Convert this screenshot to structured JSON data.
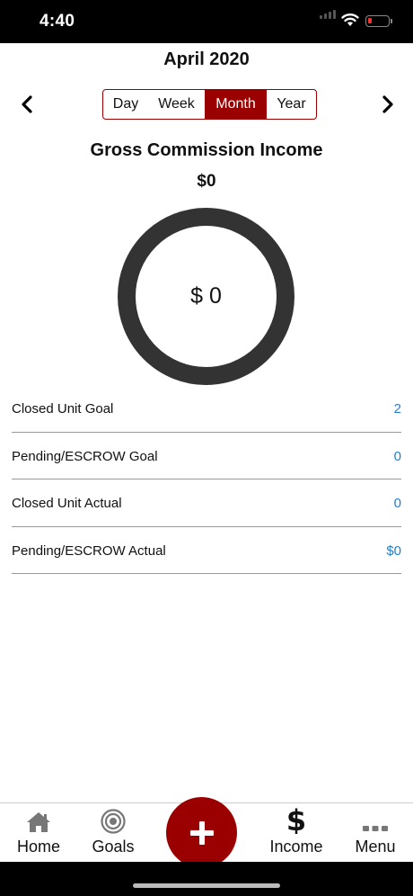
{
  "status_bar": {
    "time": "4:40"
  },
  "header": {
    "title": "April 2020"
  },
  "period_selector": {
    "options": [
      "Day",
      "Week",
      "Month",
      "Year"
    ],
    "selected": "Month"
  },
  "summary": {
    "title": "Gross Commission Income",
    "total": "$0",
    "ring_value": "$ 0"
  },
  "stats": [
    {
      "label": "Closed Unit Goal",
      "value": "2"
    },
    {
      "label": "Pending/ESCROW Goal",
      "value": "0"
    },
    {
      "label": "Closed Unit Actual",
      "value": "0"
    },
    {
      "label": "Pending/ESCROW Actual",
      "value": "$0"
    }
  ],
  "tab_bar": {
    "home": "Home",
    "goals": "Goals",
    "income": "Income",
    "menu": "Menu"
  },
  "colors": {
    "accent": "#9b0000",
    "value_blue": "#1f7fd1",
    "ring": "#333333"
  }
}
